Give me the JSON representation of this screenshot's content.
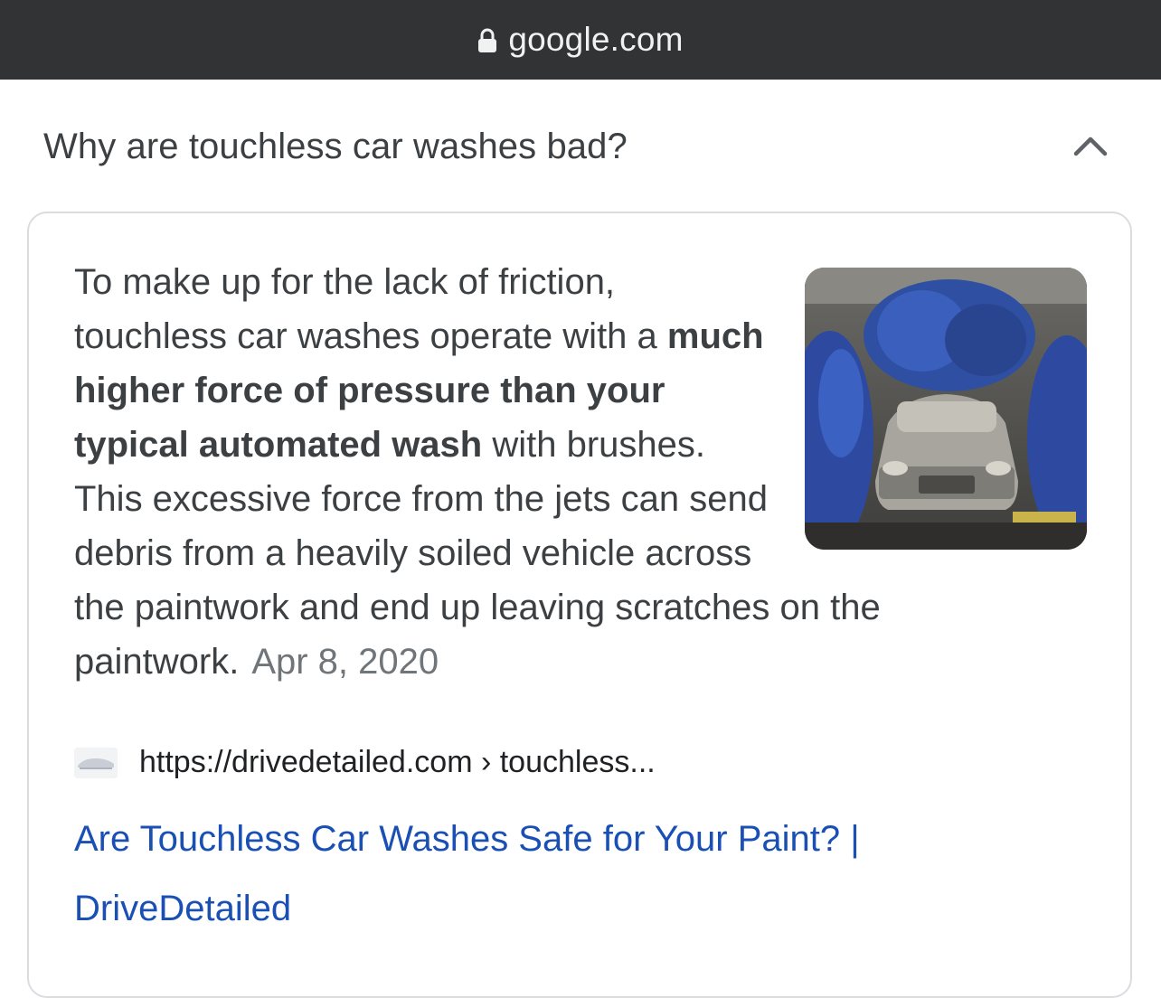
{
  "browser": {
    "url": "google.com"
  },
  "question": {
    "text": "Why are touchless car washes bad?"
  },
  "answer": {
    "text_before": "To make up for the lack of friction, touchless car washes operate with a ",
    "bold": "much higher force of pressure than your typical automated wash",
    "text_after": " with brushes. This excessive force from the jets can send debris from a heavily soiled vehicle across the paintwork and end up leaving scratches on the paintwork.",
    "date": "Apr 8, 2020"
  },
  "source": {
    "breadcrumb": "https://drivedetailed.com › touchless...",
    "title": "Are Touchless Car Washes Safe for Your Paint? | DriveDetailed"
  },
  "icons": {
    "lock": "lock-icon",
    "chevron": "chevron-up-icon",
    "favicon": "site-favicon-icon"
  },
  "colors": {
    "topbar": "#323335",
    "link": "#1a4fb4",
    "text": "#3c4043",
    "date": "#70757a",
    "border": "#dadce0"
  }
}
